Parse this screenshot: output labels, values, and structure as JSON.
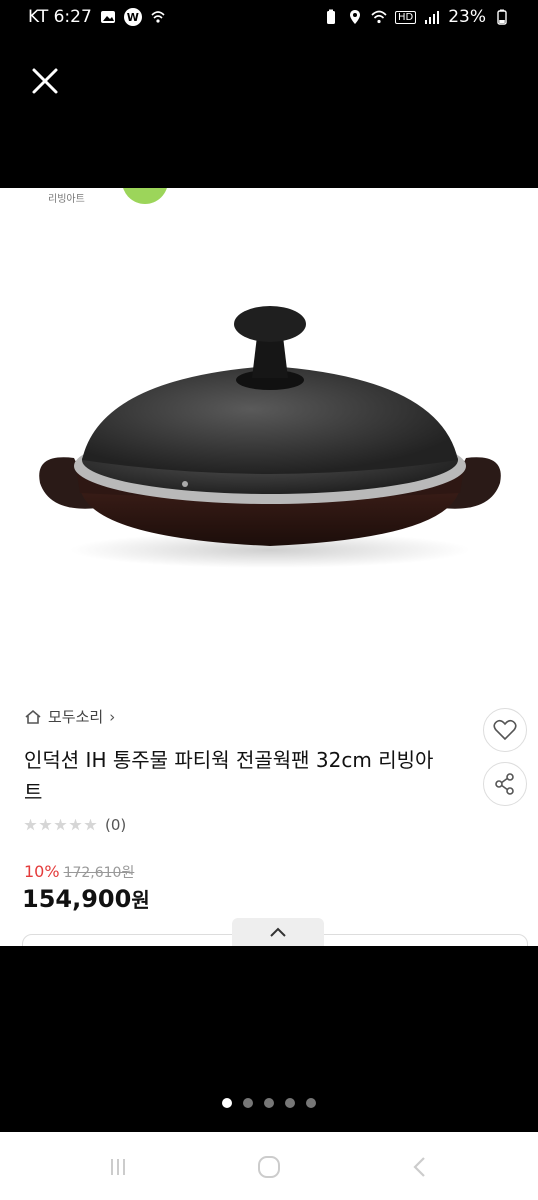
{
  "status_bar": {
    "carrier_time": "KT 6:27",
    "w_badge": "W",
    "hd_label": "HD",
    "battery": "23%"
  },
  "product": {
    "brand_small": "리빙아트",
    "store_name": "모두소리",
    "title": "인덕션 IH 통주물 파티웍 전골웍팬 32cm 리빙아트",
    "rating_count": "(0)",
    "discount_rate": "10%",
    "original_price": "172,610원",
    "sale_price_number": "154,900",
    "sale_price_unit": "원"
  },
  "gallery": {
    "image_count": 5,
    "active_index": 0
  },
  "icons": {
    "close": "close-icon",
    "home": "home-icon",
    "heart": "heart-icon",
    "share": "share-icon",
    "collapse": "chevron-up-icon",
    "recents": "recents-icon",
    "home_nav": "home-nav-icon",
    "back": "back-icon"
  },
  "colors": {
    "discount": "#e43b3b",
    "brand_leaf": "#9cd55a"
  }
}
